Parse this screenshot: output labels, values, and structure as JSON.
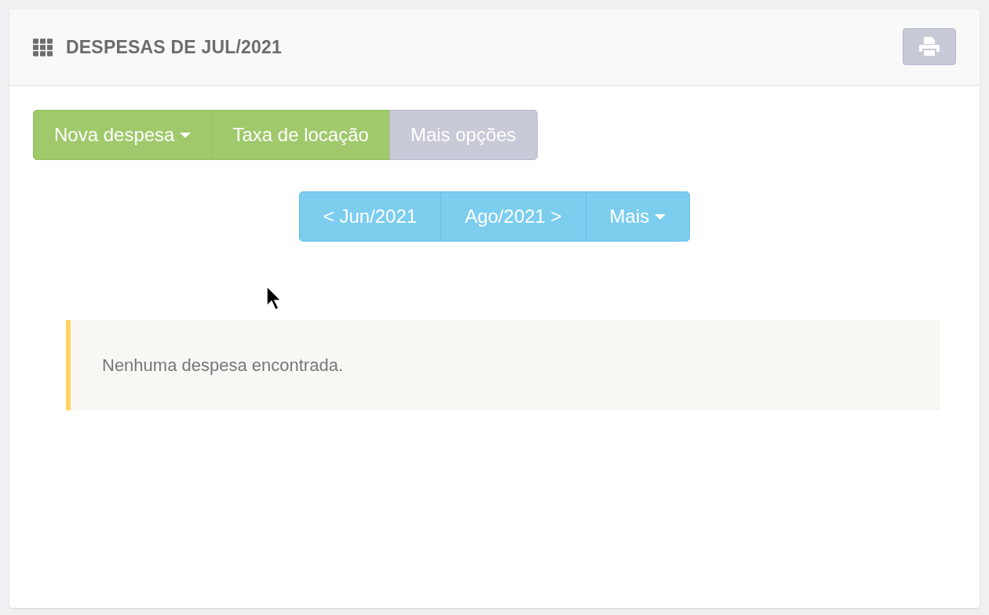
{
  "header": {
    "title": "DESPESAS DE JUL/2021"
  },
  "actions": [
    {
      "label": "Nova despesa",
      "kind": "success",
      "dropdown": true
    },
    {
      "label": "Taxa de locação",
      "kind": "success",
      "dropdown": false
    },
    {
      "label": "Mais opções",
      "kind": "default",
      "dropdown": false
    }
  ],
  "month_nav": [
    {
      "label": "< Jun/2021",
      "kind": "info",
      "dropdown": false
    },
    {
      "label": "Ago/2021 >",
      "kind": "info",
      "dropdown": false
    },
    {
      "label": "Mais",
      "kind": "info",
      "dropdown": true
    }
  ],
  "alert": {
    "text": "Nenhuma despesa encontrada."
  }
}
